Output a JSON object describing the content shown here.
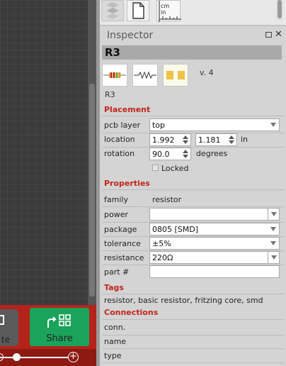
{
  "parts_strip": {
    "icons": [
      "mystery-part-icon",
      "document-icon",
      "ruler-icon"
    ],
    "ruler_units": [
      "cm",
      "in"
    ]
  },
  "canvas": {
    "route_label": "te",
    "share_label": "Share"
  },
  "inspector": {
    "title": "Inspector",
    "part_title": "R3",
    "version": "v. 4",
    "caption": "R3",
    "sections": {
      "placement": "Placement",
      "properties": "Properties",
      "tags": "Tags",
      "connections": "Connections"
    },
    "placement": {
      "pcb_layer_label": "pcb layer",
      "pcb_layer_value": "top",
      "location_label": "location",
      "location_x": "1.992",
      "location_y": "1.181",
      "location_unit": "in",
      "rotation_label": "rotation",
      "rotation_value": "90.0",
      "rotation_unit": "degrees",
      "locked_label": "Locked"
    },
    "properties": {
      "family_label": "family",
      "family_value": "resistor",
      "power_label": "power",
      "power_value": "",
      "package_label": "package",
      "package_value": "0805 [SMD]",
      "tolerance_label": "tolerance",
      "tolerance_value": "±5%",
      "resistance_label": "resistance",
      "resistance_value": "220Ω",
      "partnum_label": "part #",
      "partnum_value": ""
    },
    "tags_value": "resistor, basic resistor, fritzing core, smd",
    "connections": {
      "conn_label": "conn.",
      "name_label": "name",
      "type_label": "type"
    }
  }
}
